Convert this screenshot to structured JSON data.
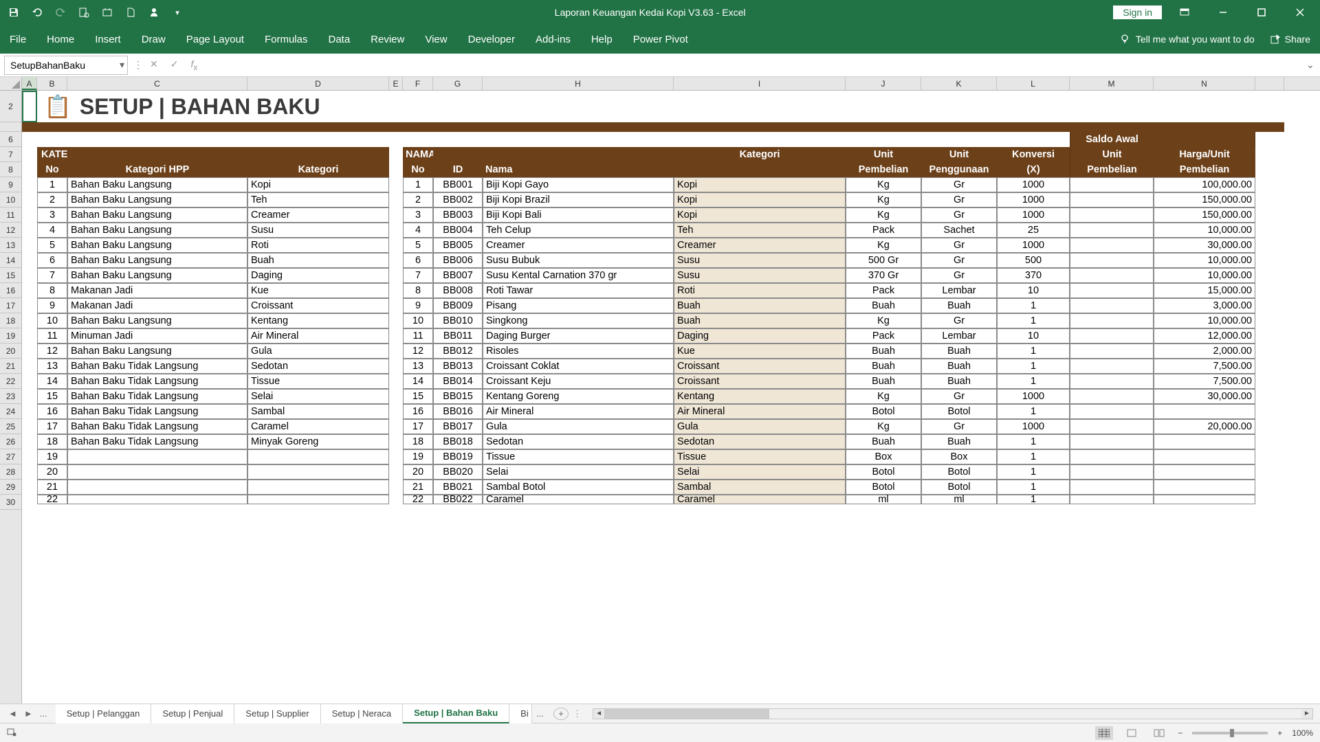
{
  "app_title": "Laporan Keuangan Kedai Kopi V3.63  -  Excel",
  "signin": "Sign in",
  "ribbon": [
    "File",
    "Home",
    "Insert",
    "Draw",
    "Page Layout",
    "Formulas",
    "Data",
    "Review",
    "View",
    "Developer",
    "Add-ins",
    "Help",
    "Power Pivot"
  ],
  "tellme": "Tell me what you want to do",
  "share": "Share",
  "namebox": "SetupBahanBaku",
  "formula_value": "",
  "page_heading": "SETUP | BAHAN BAKU",
  "columns": [
    "A",
    "B",
    "C",
    "D",
    "E",
    "F",
    "G",
    "H",
    "I",
    "J",
    "K",
    "L",
    "M",
    "N"
  ],
  "rows_visible": [
    "2",
    "",
    "6",
    "7",
    "8",
    "9",
    "10",
    "11",
    "12",
    "13",
    "14",
    "15",
    "16",
    "17",
    "18",
    "19",
    "20",
    "21",
    "22",
    "23",
    "24",
    "25",
    "26",
    "27",
    "28",
    "29",
    "30"
  ],
  "kategori_header_main": "KATEGORI BAHAN BAKU",
  "kategori_headers": {
    "no": "No",
    "hpp": "Kategori HPP",
    "kat": "Kategori"
  },
  "nama_header_main": "NAMA BAHAN BAKU",
  "nama_headers": {
    "kat": "Kategori",
    "unit": "Unit",
    "unit2": "Unit",
    "konv": "Konversi",
    "sa": "Saldo Awal",
    "unit_pembelian": "Unit",
    "harga_unit": "Harga/Unit"
  },
  "nama_sub": {
    "no": "No",
    "id": "ID",
    "nama": "Nama",
    "pembelian": "Pembelian",
    "penggunaan": "Penggunaan",
    "x": "(X)",
    "pembelian2": "Pembelian",
    "pembelian3": "Pembelian"
  },
  "kategori_rows": [
    {
      "no": 1,
      "hpp": "Bahan Baku Langsung",
      "kat": "Kopi"
    },
    {
      "no": 2,
      "hpp": "Bahan Baku Langsung",
      "kat": "Teh"
    },
    {
      "no": 3,
      "hpp": "Bahan Baku Langsung",
      "kat": "Creamer"
    },
    {
      "no": 4,
      "hpp": "Bahan Baku Langsung",
      "kat": "Susu"
    },
    {
      "no": 5,
      "hpp": "Bahan Baku Langsung",
      "kat": "Roti"
    },
    {
      "no": 6,
      "hpp": "Bahan Baku Langsung",
      "kat": "Buah"
    },
    {
      "no": 7,
      "hpp": "Bahan Baku Langsung",
      "kat": "Daging"
    },
    {
      "no": 8,
      "hpp": "Makanan Jadi",
      "kat": "Kue"
    },
    {
      "no": 9,
      "hpp": "Makanan Jadi",
      "kat": "Croissant"
    },
    {
      "no": 10,
      "hpp": "Bahan Baku Langsung",
      "kat": "Kentang"
    },
    {
      "no": 11,
      "hpp": "Minuman Jadi",
      "kat": "Air Mineral"
    },
    {
      "no": 12,
      "hpp": "Bahan Baku Langsung",
      "kat": "Gula"
    },
    {
      "no": 13,
      "hpp": "Bahan Baku Tidak Langsung",
      "kat": "Sedotan"
    },
    {
      "no": 14,
      "hpp": "Bahan Baku Tidak Langsung",
      "kat": "Tissue"
    },
    {
      "no": 15,
      "hpp": "Bahan Baku Tidak Langsung",
      "kat": "Selai"
    },
    {
      "no": 16,
      "hpp": "Bahan Baku Tidak Langsung",
      "kat": "Sambal"
    },
    {
      "no": 17,
      "hpp": "Bahan Baku Tidak Langsung",
      "kat": "Caramel"
    },
    {
      "no": 18,
      "hpp": "Bahan Baku Tidak Langsung",
      "kat": "Minyak Goreng"
    },
    {
      "no": 19,
      "hpp": "",
      "kat": ""
    },
    {
      "no": 20,
      "hpp": "",
      "kat": ""
    },
    {
      "no": 21,
      "hpp": "",
      "kat": ""
    },
    {
      "no": 22,
      "hpp": "",
      "kat": ""
    }
  ],
  "nama_rows": [
    {
      "no": 1,
      "id": "BB001",
      "nama": "Biji Kopi Gayo",
      "kat": "Kopi",
      "up": "Kg",
      "uu": "Gr",
      "x": "1000",
      "sa": "",
      "hu": "100,000.00"
    },
    {
      "no": 2,
      "id": "BB002",
      "nama": "Biji Kopi Brazil",
      "kat": "Kopi",
      "up": "Kg",
      "uu": "Gr",
      "x": "1000",
      "sa": "",
      "hu": "150,000.00"
    },
    {
      "no": 3,
      "id": "BB003",
      "nama": "Biji Kopi Bali",
      "kat": "Kopi",
      "up": "Kg",
      "uu": "Gr",
      "x": "1000",
      "sa": "",
      "hu": "150,000.00"
    },
    {
      "no": 4,
      "id": "BB004",
      "nama": "Teh Celup",
      "kat": "Teh",
      "up": "Pack",
      "uu": "Sachet",
      "x": "25",
      "sa": "",
      "hu": "10,000.00"
    },
    {
      "no": 5,
      "id": "BB005",
      "nama": "Creamer",
      "kat": "Creamer",
      "up": "Kg",
      "uu": "Gr",
      "x": "1000",
      "sa": "",
      "hu": "30,000.00"
    },
    {
      "no": 6,
      "id": "BB006",
      "nama": "Susu Bubuk",
      "kat": "Susu",
      "up": "500 Gr",
      "uu": "Gr",
      "x": "500",
      "sa": "",
      "hu": "10,000.00"
    },
    {
      "no": 7,
      "id": "BB007",
      "nama": "Susu Kental Carnation 370 gr",
      "kat": "Susu",
      "up": "370 Gr",
      "uu": "Gr",
      "x": "370",
      "sa": "",
      "hu": "10,000.00"
    },
    {
      "no": 8,
      "id": "BB008",
      "nama": "Roti Tawar",
      "kat": "Roti",
      "up": "Pack",
      "uu": "Lembar",
      "x": "10",
      "sa": "",
      "hu": "15,000.00"
    },
    {
      "no": 9,
      "id": "BB009",
      "nama": "Pisang",
      "kat": "Buah",
      "up": "Buah",
      "uu": "Buah",
      "x": "1",
      "sa": "",
      "hu": "3,000.00"
    },
    {
      "no": 10,
      "id": "BB010",
      "nama": "Singkong",
      "kat": "Buah",
      "up": "Kg",
      "uu": "Gr",
      "x": "1",
      "sa": "",
      "hu": "10,000.00"
    },
    {
      "no": 11,
      "id": "BB011",
      "nama": "Daging Burger",
      "kat": "Daging",
      "up": "Pack",
      "uu": "Lembar",
      "x": "10",
      "sa": "",
      "hu": "12,000.00"
    },
    {
      "no": 12,
      "id": "BB012",
      "nama": "Risoles",
      "kat": "Kue",
      "up": "Buah",
      "uu": "Buah",
      "x": "1",
      "sa": "",
      "hu": "2,000.00"
    },
    {
      "no": 13,
      "id": "BB013",
      "nama": "Croissant Coklat",
      "kat": "Croissant",
      "up": "Buah",
      "uu": "Buah",
      "x": "1",
      "sa": "",
      "hu": "7,500.00"
    },
    {
      "no": 14,
      "id": "BB014",
      "nama": "Croissant Keju",
      "kat": "Croissant",
      "up": "Buah",
      "uu": "Buah",
      "x": "1",
      "sa": "",
      "hu": "7,500.00"
    },
    {
      "no": 15,
      "id": "BB015",
      "nama": "Kentang Goreng",
      "kat": "Kentang",
      "up": "Kg",
      "uu": "Gr",
      "x": "1000",
      "sa": "",
      "hu": "30,000.00"
    },
    {
      "no": 16,
      "id": "BB016",
      "nama": "Air Mineral",
      "kat": "Air Mineral",
      "up": "Botol",
      "uu": "Botol",
      "x": "1",
      "sa": "",
      "hu": ""
    },
    {
      "no": 17,
      "id": "BB017",
      "nama": "Gula",
      "kat": "Gula",
      "up": "Kg",
      "uu": "Gr",
      "x": "1000",
      "sa": "",
      "hu": "20,000.00"
    },
    {
      "no": 18,
      "id": "BB018",
      "nama": "Sedotan",
      "kat": "Sedotan",
      "up": "Buah",
      "uu": "Buah",
      "x": "1",
      "sa": "",
      "hu": ""
    },
    {
      "no": 19,
      "id": "BB019",
      "nama": "Tissue",
      "kat": "Tissue",
      "up": "Box",
      "uu": "Box",
      "x": "1",
      "sa": "",
      "hu": ""
    },
    {
      "no": 20,
      "id": "BB020",
      "nama": "Selai",
      "kat": "Selai",
      "up": "Botol",
      "uu": "Botol",
      "x": "1",
      "sa": "",
      "hu": ""
    },
    {
      "no": 21,
      "id": "BB021",
      "nama": "Sambal Botol",
      "kat": "Sambal",
      "up": "Botol",
      "uu": "Botol",
      "x": "1",
      "sa": "",
      "hu": ""
    },
    {
      "no": 22,
      "id": "BB022",
      "nama": "Caramel",
      "kat": "Caramel",
      "up": "ml",
      "uu": "ml",
      "x": "1",
      "sa": "",
      "hu": ""
    }
  ],
  "ws_tabs": [
    "Setup | Pelanggan",
    "Setup | Penjual",
    "Setup | Supplier",
    "Setup | Neraca",
    "Setup | Bahan Baku",
    "Bi"
  ],
  "ws_active": 4,
  "ws_ellipsis": "...",
  "zoom": "100%"
}
